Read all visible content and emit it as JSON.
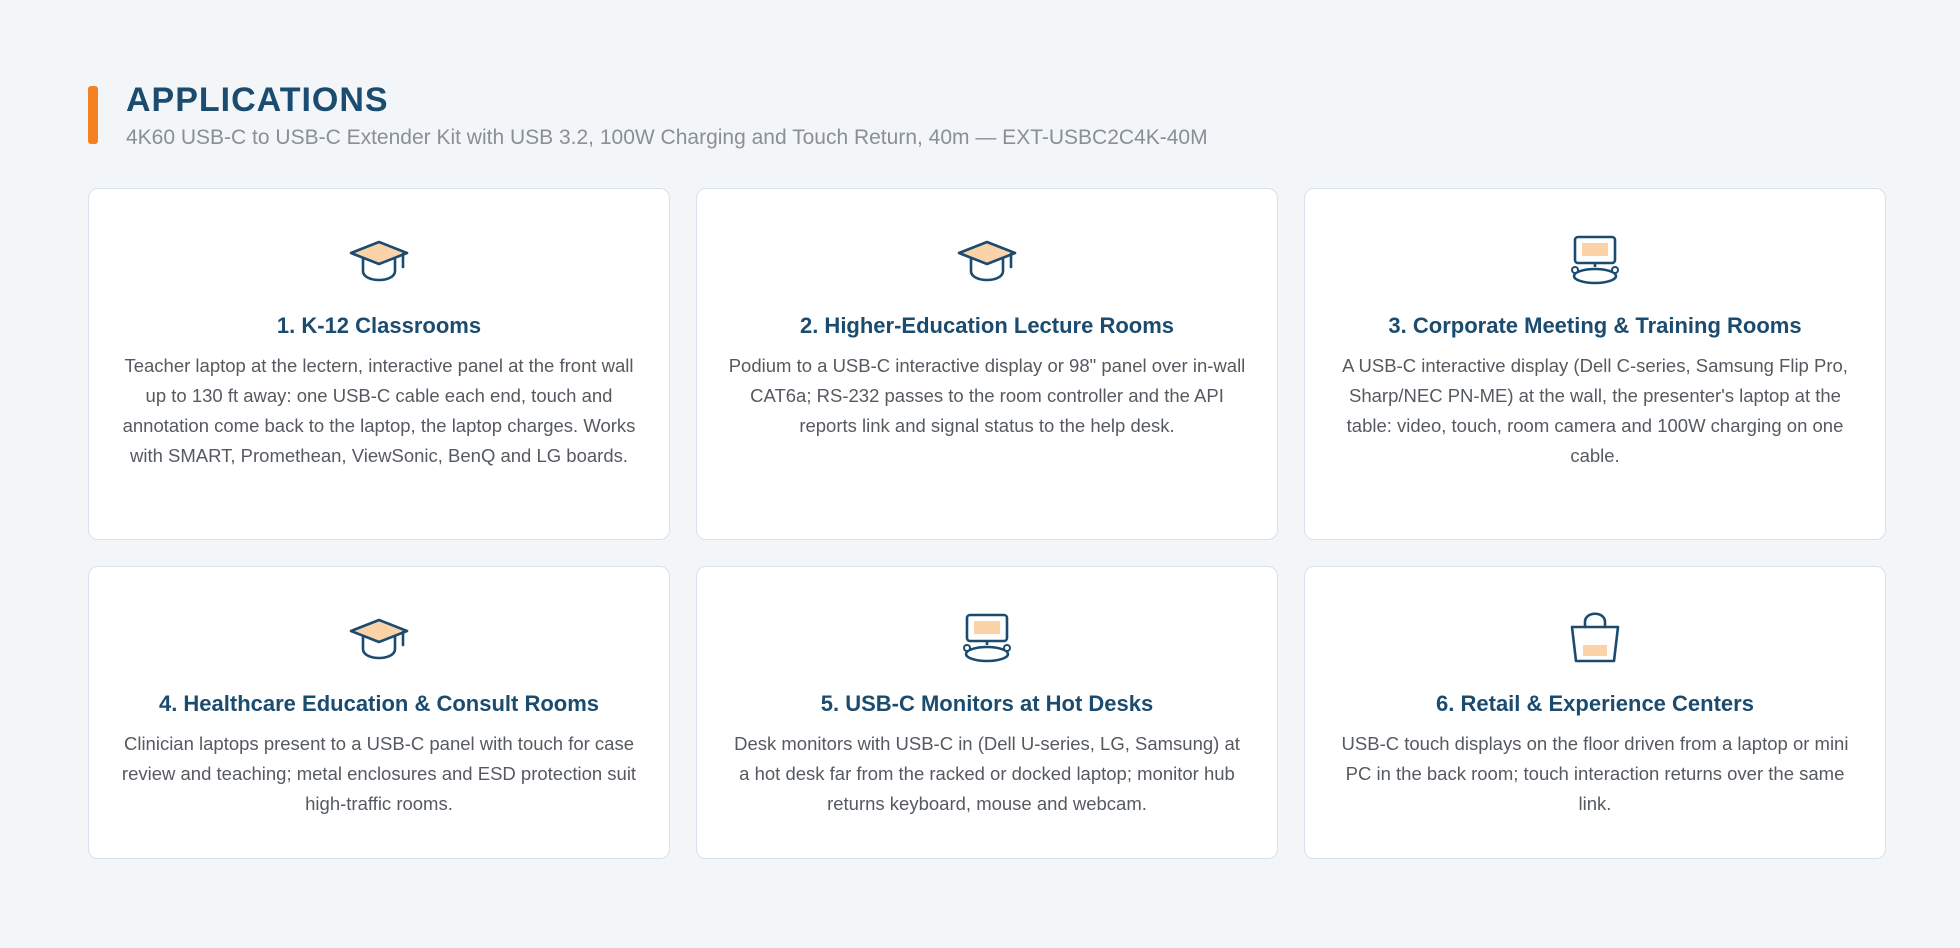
{
  "colors": {
    "accent": "#f58220",
    "heading": "#1b4b6f",
    "icon_stroke": "#1b4b6f",
    "icon_fill": "#fcd3a8"
  },
  "header": {
    "title": "APPLICATIONS",
    "subtitle": "4K60 USB-C to USB-C Extender Kit with USB 3.2, 100W Charging and Touch Return, 40m — EXT-USBC2C4K-40M"
  },
  "cards": [
    {
      "icon": "graduation-cap-icon",
      "title": "1. K-12 Classrooms",
      "body": "Teacher laptop at the lectern, interactive panel at the front wall up to 130 ft away: one USB-C cable each end, touch and annotation come back to the laptop, the laptop charges. Works with SMART, Promethean, ViewSonic, BenQ and LG boards."
    },
    {
      "icon": "graduation-cap-icon",
      "title": "2. Higher-Education Lecture Rooms",
      "body": "Podium to a USB-C interactive display or 98\" panel over in-wall CAT6a; RS-232 passes to the room controller and the API reports link and signal status to the help desk."
    },
    {
      "icon": "meeting-room-icon",
      "title": "3. Corporate Meeting & Training Rooms",
      "body": "A USB-C interactive display (Dell C-series, Samsung Flip Pro, Sharp/NEC PN-ME) at the wall, the presenter's laptop at the table: video, touch, room camera and 100W charging on one cable."
    },
    {
      "icon": "graduation-cap-icon",
      "title": "4. Healthcare Education & Consult Rooms",
      "body": "Clinician laptops present to a USB-C panel with touch for case review and teaching; metal enclosures and ESD protection suit high-traffic rooms."
    },
    {
      "icon": "meeting-room-icon",
      "title": "5. USB-C Monitors at Hot Desks",
      "body": "Desk monitors with USB-C in (Dell U-series, LG, Samsung) at a hot desk far from the racked or docked laptop; monitor hub returns keyboard, mouse and webcam."
    },
    {
      "icon": "shopping-bag-icon",
      "title": "6. Retail & Experience Centers",
      "body": "USB-C touch displays on the floor driven from a laptop or mini PC in the back room; touch interaction returns over the same link."
    }
  ]
}
